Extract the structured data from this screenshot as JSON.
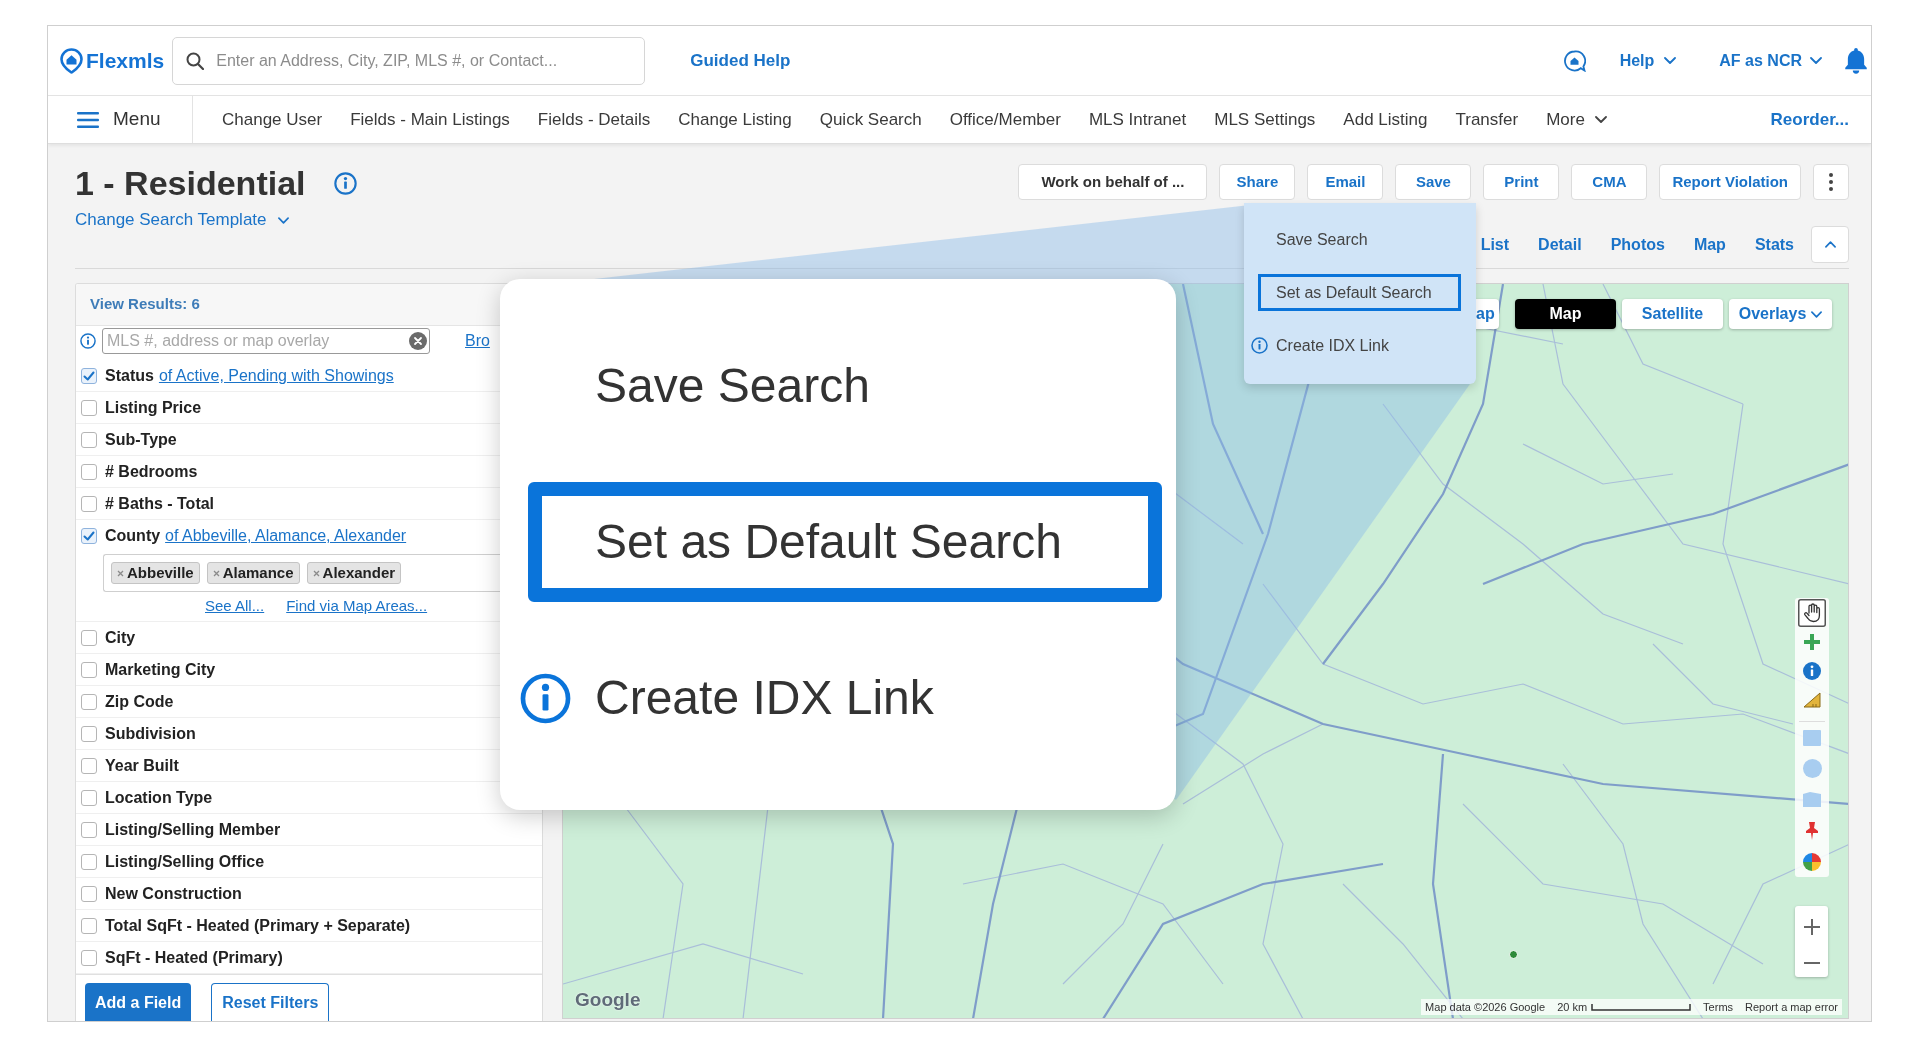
{
  "header": {
    "logo": "Flexmls",
    "search": {
      "placeholder": "Enter an Address, City, ZIP, MLS #, or Contact..."
    },
    "guided_help": "Guided Help",
    "help_menu": "Help",
    "user_menu": "AF as NCR"
  },
  "nav": {
    "menu": "Menu",
    "items": [
      "Change User",
      "Fields - Main Listings",
      "Fields - Details",
      "Change Listing",
      "Quick Search",
      "Office/Member",
      "MLS Intranet",
      "MLS Settings",
      "Add Listing",
      "Transfer"
    ],
    "more": "More",
    "reorder": "Reorder..."
  },
  "page": {
    "title": "1 - Residential",
    "template_link": "Change Search Template",
    "actions": [
      {
        "label": "Work on behalf of ...",
        "kind": "menu"
      },
      {
        "label": "Share",
        "kind": "action"
      },
      {
        "label": "Email",
        "kind": "action"
      },
      {
        "label": "Save",
        "kind": "action"
      },
      {
        "label": "Print",
        "kind": "action"
      },
      {
        "label": "CMA",
        "kind": "action"
      },
      {
        "label": "Report Violation",
        "kind": "action"
      }
    ],
    "view_tabs": [
      "List",
      "Detail",
      "Photos",
      "Map",
      "Stats"
    ]
  },
  "dropdown": {
    "items": [
      {
        "label": "Save Search",
        "kind": "action",
        "selected": false
      },
      {
        "label": "Set as Default Search",
        "kind": "action",
        "selected": true
      },
      {
        "label": "Create IDX Link",
        "kind": "info_link",
        "selected": false
      }
    ]
  },
  "callout": {
    "items": [
      {
        "label": "Save Search",
        "kind": "action",
        "selected": false
      },
      {
        "label": "Set as Default Search",
        "kind": "action",
        "selected": true
      },
      {
        "label": "Create IDX Link",
        "kind": "info_link",
        "selected": false
      }
    ]
  },
  "filters": {
    "view_results": "View Results: 6",
    "search": {
      "placeholder": "MLS #, address or map overlay"
    },
    "browse_link": "Bro",
    "rows": [
      {
        "label": "Status",
        "checked": true,
        "summary": "of Active, Pending with Showings"
      },
      {
        "label": "Listing Price",
        "checked": false
      },
      {
        "label": "Sub-Type",
        "checked": false
      },
      {
        "label": "# Bedrooms",
        "checked": false
      },
      {
        "label": "# Baths - Total",
        "checked": false
      },
      {
        "label": "County",
        "checked": true,
        "summary": "of Abbeville, Alamance, Alexander",
        "chips": [
          "Abbeville",
          "Alamance",
          "Alexander"
        ],
        "links": [
          "See All...",
          "Find via Map Areas..."
        ]
      },
      {
        "label": "City",
        "checked": false
      },
      {
        "label": "Marketing City",
        "checked": false
      },
      {
        "label": "Zip Code",
        "checked": false
      },
      {
        "label": "Subdivision",
        "checked": false
      },
      {
        "label": "Year Built",
        "checked": false
      },
      {
        "label": "Location Type",
        "checked": false
      },
      {
        "label": "Listing/Selling Member",
        "checked": false
      },
      {
        "label": "Listing/Selling Office",
        "checked": false
      },
      {
        "label": "New Construction",
        "checked": false
      },
      {
        "label": "Total SqFt - Heated (Primary + Separate)",
        "checked": false
      },
      {
        "label": "SqFt - Heated (Primary)",
        "checked": false
      }
    ],
    "buttons": [
      {
        "label": "Add a Field",
        "kind": "primary"
      },
      {
        "label": "Reset Filters",
        "kind": "secondary"
      }
    ]
  },
  "map": {
    "view_buttons": [
      {
        "label": "ap",
        "selected": false
      },
      {
        "label": "Map",
        "selected": true
      },
      {
        "label": "Satellite",
        "selected": false
      }
    ],
    "overlays": "Overlays",
    "logo": "Google",
    "attribution": "Map data ©2026 Google",
    "scale": "20 km",
    "terms": "Terms",
    "report": "Report a map error"
  }
}
